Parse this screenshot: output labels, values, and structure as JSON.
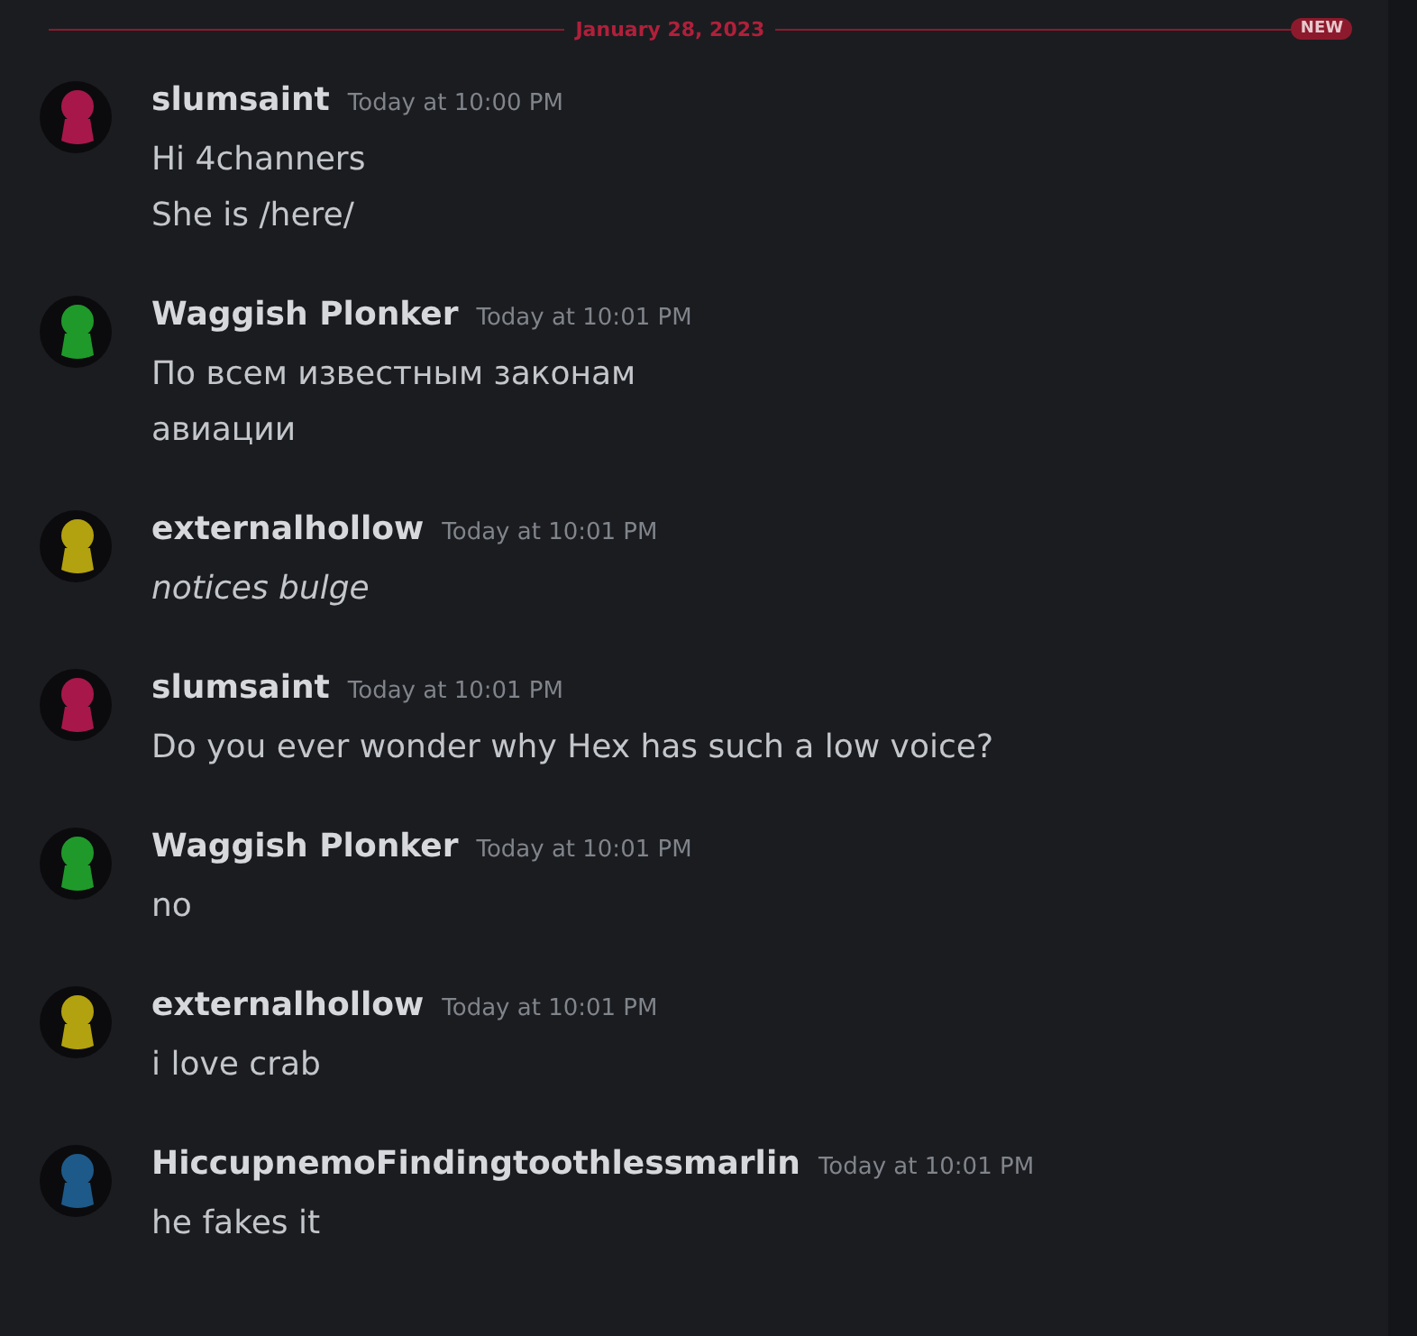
{
  "divider": {
    "date": "January 28, 2023",
    "badge": "NEW"
  },
  "messages": [
    {
      "author": "slumsaint",
      "color": "#a8174a",
      "time": "Today at 10:00 PM",
      "lines": [
        {
          "text": "Hi 4channers",
          "italic": false
        },
        {
          "text": "She is /here/",
          "italic": false
        }
      ]
    },
    {
      "author": "Waggish Plonker",
      "color": "#1f9a2a",
      "time": "Today at 10:01 PM",
      "lines": [
        {
          "text": "По всем известным законам",
          "italic": false
        },
        {
          "text": "авиации",
          "italic": false
        }
      ]
    },
    {
      "author": "externalhollow",
      "color": "#b3a20f",
      "time": "Today at 10:01 PM",
      "lines": [
        {
          "text": "notices bulge",
          "italic": true
        }
      ]
    },
    {
      "author": "slumsaint",
      "color": "#a8174a",
      "time": "Today at 10:01 PM",
      "lines": [
        {
          "text": "Do you ever wonder why Hex has such a low voice?",
          "italic": false
        }
      ]
    },
    {
      "author": "Waggish Plonker",
      "color": "#1f9a2a",
      "time": "Today at 10:01 PM",
      "lines": [
        {
          "text": "no",
          "italic": false
        }
      ]
    },
    {
      "author": "externalhollow",
      "color": "#b3a20f",
      "time": "Today at 10:01 PM",
      "lines": [
        {
          "text": "i love crab",
          "italic": false
        }
      ]
    },
    {
      "author": "HiccupnemoFindingtoothlessmarlin",
      "color": "#1d5a8a",
      "time": "Today at 10:01 PM",
      "lines": [
        {
          "text": "he fakes it",
          "italic": false
        }
      ]
    }
  ]
}
